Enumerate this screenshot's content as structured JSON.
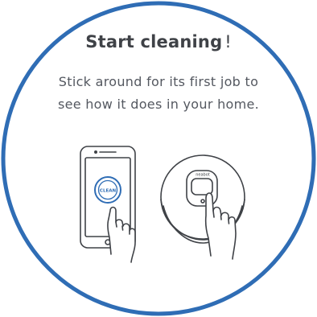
{
  "card": {
    "title_strong": "Start cleaning",
    "title_mark": "!",
    "line1": "Stick around for its first job to",
    "line2": "see how it does in your home.",
    "border_color": "#2f6db5"
  },
  "phone": {
    "button_label": "CLEAN",
    "button_color": "#2f6db5"
  },
  "robot": {
    "brand_label": "neabot"
  },
  "icons": [
    "phone-illustration",
    "robot-vacuum-illustration",
    "pointing-hand-icon"
  ]
}
